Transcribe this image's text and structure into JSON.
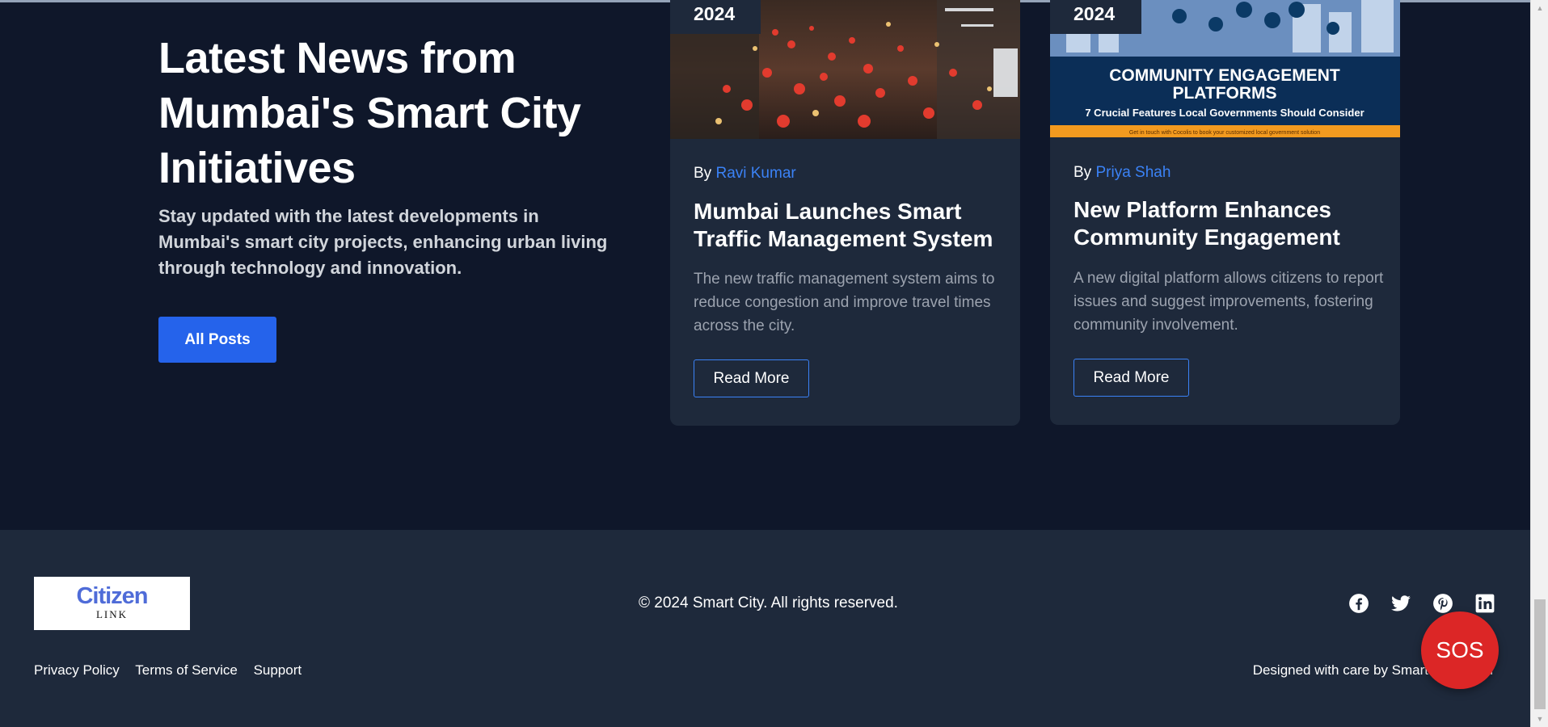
{
  "hero": {
    "title": "Latest News from Mumbai's Smart City Initiatives",
    "description": "Stay updated with the latest developments in Mumbai's smart city projects, enhancing urban living through technology and innovation.",
    "all_posts_label": "All Posts"
  },
  "posts": [
    {
      "year": "2024",
      "by": "By",
      "author": "Ravi Kumar",
      "title": "Mumbai Launches Smart Traffic Management System",
      "description": "The new traffic management system aims to reduce congestion and improve travel times across the city.",
      "read_more": "Read More"
    },
    {
      "year": "2024",
      "by": "By",
      "author": "Priya Shah",
      "title": "New Platform Enhances Community Engagement",
      "description": "A new digital platform allows citizens to report issues and suggest improvements, fostering community involvement.",
      "read_more": "Read More",
      "image_text": {
        "heading_line1": "COMMUNITY ENGAGEMENT",
        "heading_line2": "PLATFORMS",
        "subheading": "7 Crucial Features Local Governments Should Consider",
        "footnote": "Get in touch with Cocolis to book your customized local government solution"
      }
    }
  ],
  "footer": {
    "logo_main": "Citizen",
    "logo_sub": "LINK",
    "copyright": "© 2024 Smart City. All rights reserved.",
    "links": [
      "Privacy Policy",
      "Terms of Service",
      "Support"
    ],
    "designed_by": "Designed with care by Smart City Team",
    "socials": [
      "facebook-icon",
      "twitter-icon",
      "pinterest-icon",
      "linkedin-icon"
    ]
  },
  "sos_label": "SOS",
  "colors": {
    "background": "#0f172a",
    "card": "#1e293b",
    "accent": "#2563eb",
    "link": "#3b82f6",
    "sos": "#dc2626"
  }
}
